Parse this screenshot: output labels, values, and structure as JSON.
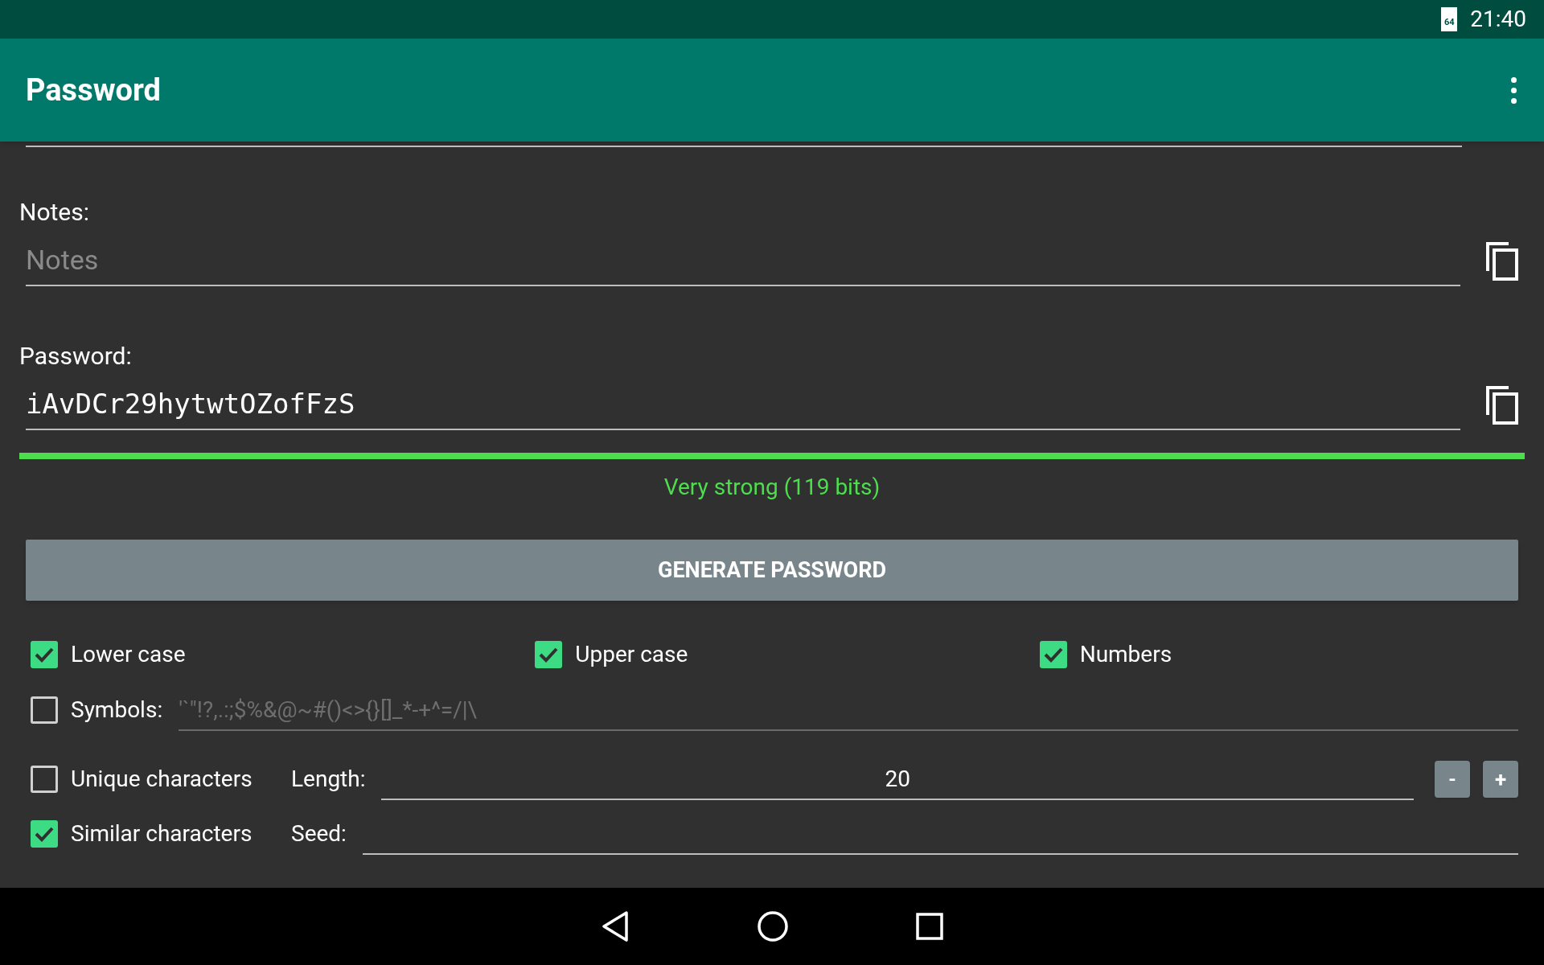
{
  "status_bar": {
    "battery_label": "64",
    "time": "21:40"
  },
  "app_bar": {
    "title": "Password"
  },
  "fields": [
    {
      "kind": "text",
      "label": "Notes:",
      "placeholder": "Notes"
    },
    {
      "kind": "password",
      "label": "Password:",
      "value": "iAvDCr29hytwtOZofFzS"
    }
  ],
  "strength": {
    "level": 1,
    "text": "Very strong (119 bits)",
    "color": "#4ddd4d"
  },
  "generate_button": "GENERATE PASSWORD",
  "options": [
    {
      "label": "Lower case",
      "checked": true
    },
    {
      "label": "Upper case",
      "checked": true
    },
    {
      "label": "Numbers",
      "checked": true
    }
  ],
  "symbols": {
    "label": "Symbols:",
    "checked": false,
    "placeholder": "'`\"!?,.:;$%&@~#()<>{}[]_*-+^=/|\\"
  },
  "unique": {
    "label": "Unique characters",
    "checked": false
  },
  "length": {
    "label": "Length:",
    "value": "20",
    "minus": "-",
    "plus": "+"
  },
  "similar": {
    "label": "Similar characters",
    "checked": true
  },
  "seed": {
    "label": "Seed:"
  }
}
